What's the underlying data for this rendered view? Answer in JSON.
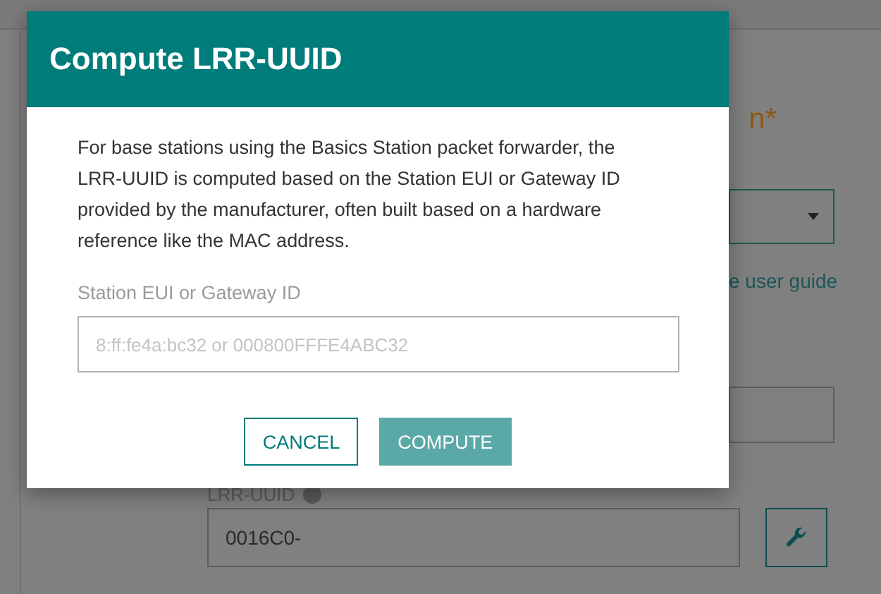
{
  "background": {
    "heading": "n*",
    "link": "e user guide",
    "lrr_uuid": {
      "label": "LRR-UUID",
      "value": "0016C0-"
    }
  },
  "dialog": {
    "title": "Compute LRR-UUID",
    "description": "For base stations using the Basics Station packet forwarder, the LRR-UUID is computed based on the Station EUI or Gateway ID provided by the manufacturer, often built based on a hardware reference like the MAC address.",
    "field": {
      "label": "Station EUI or Gateway ID",
      "placeholder": "8:ff:fe4a:bc32 or 000800FFFE4ABC32"
    },
    "buttons": [
      {
        "label": "CANCEL",
        "kind": "secondary"
      },
      {
        "label": "COMPUTE",
        "kind": "primary"
      }
    ]
  }
}
